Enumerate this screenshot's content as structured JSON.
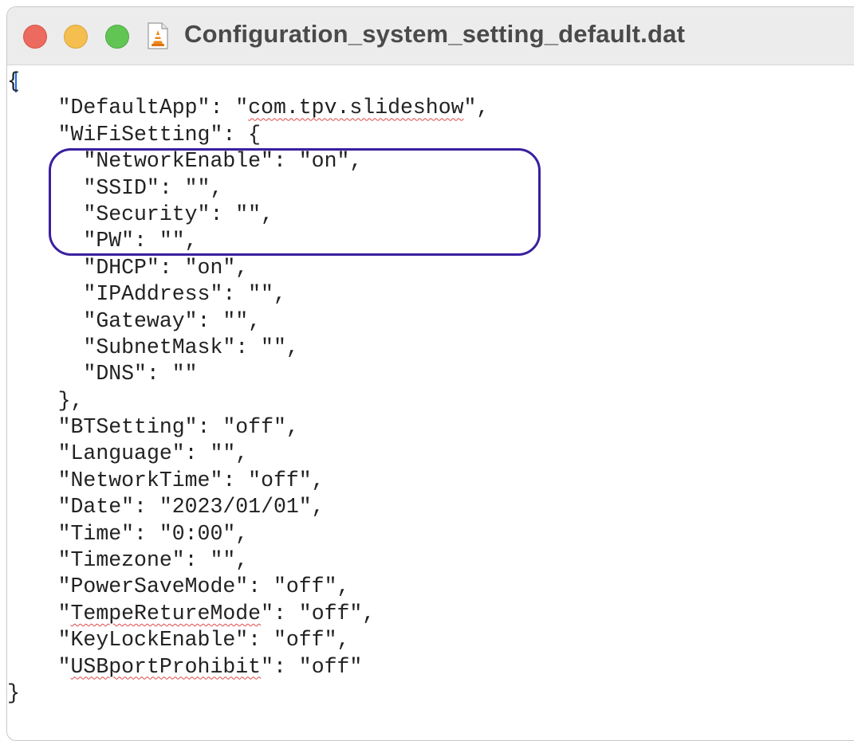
{
  "window": {
    "title": "Configuration_system_setting_default.dat",
    "file_icon": "vlc-cone-document-icon"
  },
  "colors": {
    "close": "#ed6a5e",
    "minimize": "#f5bf4f",
    "zoom": "#61c554",
    "highlight_border": "#3a1fa0",
    "spell_underline": "#e04848",
    "caret": "#1a6fe6"
  },
  "editor": {
    "lines": [
      {
        "indent": "",
        "parts": [
          {
            "text": "{"
          }
        ]
      },
      {
        "indent": "    ",
        "parts": [
          {
            "text": "\"DefaultApp\": \""
          },
          {
            "text": "com.tpv.slideshow",
            "spell": true
          },
          {
            "text": "\","
          }
        ]
      },
      {
        "indent": "    ",
        "parts": [
          {
            "text": "\"WiFiSetting\": {"
          }
        ]
      },
      {
        "indent": "      ",
        "parts": [
          {
            "text": "\"NetworkEnable\": \"on\","
          }
        ]
      },
      {
        "indent": "      ",
        "parts": [
          {
            "text": "\"SSID\": \"\","
          }
        ]
      },
      {
        "indent": "      ",
        "parts": [
          {
            "text": "\"Security\": \"\","
          }
        ]
      },
      {
        "indent": "      ",
        "parts": [
          {
            "text": "\"PW\": \"\","
          }
        ]
      },
      {
        "indent": "      ",
        "parts": [
          {
            "text": "\"DHCP\": \"on\","
          }
        ]
      },
      {
        "indent": "      ",
        "parts": [
          {
            "text": "\"IPAddress\": \"\","
          }
        ]
      },
      {
        "indent": "      ",
        "parts": [
          {
            "text": "\"Gateway\": \"\","
          }
        ]
      },
      {
        "indent": "      ",
        "parts": [
          {
            "text": "\"SubnetMask\": \"\","
          }
        ]
      },
      {
        "indent": "      ",
        "parts": [
          {
            "text": "\"DNS\": \"\""
          }
        ]
      },
      {
        "indent": "    ",
        "parts": [
          {
            "text": "},"
          }
        ]
      },
      {
        "indent": "    ",
        "parts": [
          {
            "text": "\"BTSetting\": \"off\","
          }
        ]
      },
      {
        "indent": "    ",
        "parts": [
          {
            "text": "\"Language\": \"\","
          }
        ]
      },
      {
        "indent": "    ",
        "parts": [
          {
            "text": "\"NetworkTime\": \"off\","
          }
        ]
      },
      {
        "indent": "    ",
        "parts": [
          {
            "text": "\"Date\": \"2023/01/01\","
          }
        ]
      },
      {
        "indent": "    ",
        "parts": [
          {
            "text": "\"Time\": \"0:00\","
          }
        ]
      },
      {
        "indent": "    ",
        "parts": [
          {
            "text": "\"Timezone\": \"\","
          }
        ]
      },
      {
        "indent": "    ",
        "parts": [
          {
            "text": "\"PowerSaveMode\": \"off\","
          }
        ]
      },
      {
        "indent": "    ",
        "parts": [
          {
            "text": "\""
          },
          {
            "text": "TempeRetureMode",
            "spell": true
          },
          {
            "text": "\": \"off\","
          }
        ]
      },
      {
        "indent": "    ",
        "parts": [
          {
            "text": "\"KeyLockEnable\": \"off\","
          }
        ]
      },
      {
        "indent": "    ",
        "parts": [
          {
            "text": "\""
          },
          {
            "text": "USBportProhibit",
            "spell": true
          },
          {
            "text": "\": \"off\""
          }
        ]
      },
      {
        "indent": "",
        "parts": [
          {
            "text": "}"
          }
        ]
      }
    ]
  }
}
